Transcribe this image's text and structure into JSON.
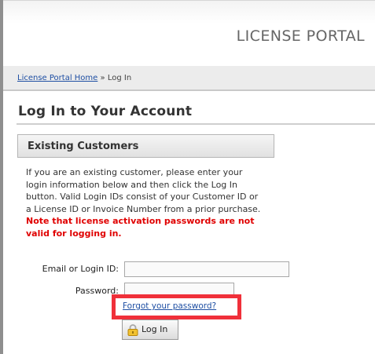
{
  "header": {
    "title": "LICENSE PORTAL"
  },
  "breadcrumb": {
    "home_link": "License Portal Home",
    "separator": "»",
    "current": "Log In"
  },
  "page": {
    "heading": "Log In to Your Account"
  },
  "section": {
    "title": "Existing Customers",
    "intro": "If you are an existing customer, please enter your login information below and then click the Log In button. Valid Login IDs consist of your Customer ID or a License ID or Invoice Number from a prior purchase.",
    "warning": "Note that license activation passwords are not valid for logging in."
  },
  "form": {
    "email_label": "Email or Login ID:",
    "email_value": "",
    "password_label": "Password:",
    "password_value": "",
    "forgot_link": "Forgot your password?",
    "login_button": "Log In"
  },
  "colors": {
    "link": "#1f4fa3",
    "warning": "#e00000",
    "highlight": "#f0303a"
  },
  "icons": {
    "login_button": "lock-icon"
  }
}
